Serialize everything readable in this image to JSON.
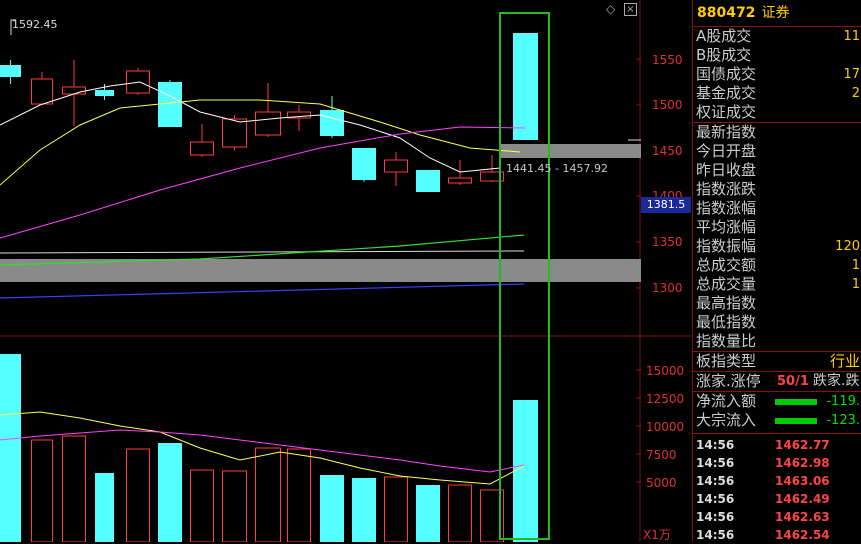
{
  "stock": {
    "code": "880472",
    "name": "证券"
  },
  "chart": {
    "top_label": "1592.45",
    "range_label": "1441.45 - 1457.92",
    "price_marker": "1381.5",
    "unit_label": "X1万",
    "price_ticks": [
      "1550",
      "1500",
      "1450",
      "1400",
      "1350",
      "1300"
    ],
    "vol_ticks": [
      "15000",
      "12500",
      "10000",
      "7500",
      "5000"
    ],
    "colors": {
      "up": "#ff3b3b",
      "down": "#55ffff",
      "ma5": "#ffffff",
      "ma10": "#ffff55",
      "ma20": "#ff44ff",
      "ma60": "#33dd33",
      "ma120": "#dddddd",
      "ma250": "#3344ff",
      "highlight": "#22bb22"
    }
  },
  "panel": {
    "rows": [
      {
        "label": "A股成交",
        "value": "11"
      },
      {
        "label": "B股成交",
        "value": ""
      },
      {
        "label": "国债成交",
        "value": "17"
      },
      {
        "label": "基金成交",
        "value": "2"
      },
      {
        "label": "权证成交",
        "value": ""
      }
    ],
    "rows2": [
      {
        "label": "最新指数",
        "value": ""
      },
      {
        "label": "今日开盘",
        "value": ""
      },
      {
        "label": "昨日收盘",
        "value": ""
      },
      {
        "label": "指数涨跌",
        "value": ""
      },
      {
        "label": "指数涨幅",
        "value": ""
      },
      {
        "label": "平均涨幅",
        "value": ""
      },
      {
        "label": "指数振幅",
        "value": "120"
      },
      {
        "label": "总成交额",
        "value": "1"
      },
      {
        "label": "总成交量",
        "value": "1"
      },
      {
        "label": "最高指数",
        "value": ""
      },
      {
        "label": "最低指数",
        "value": ""
      },
      {
        "label": "指数量比",
        "value": ""
      }
    ],
    "type_label": "板指类型",
    "type_value": "行业",
    "limit_label": "涨家.涨停",
    "limit_value": "50/1",
    "limit_extra": "跌家.跌",
    "flows": [
      {
        "label": "净流入额",
        "value": "-119."
      },
      {
        "label": "大宗流入",
        "value": "-123."
      }
    ],
    "ticks": [
      {
        "time": "14:56",
        "price": "1462.77"
      },
      {
        "time": "14:56",
        "price": "1462.98"
      },
      {
        "time": "14:56",
        "price": "1463.06"
      },
      {
        "time": "14:56",
        "price": "1462.49"
      },
      {
        "time": "14:56",
        "price": "1462.63"
      },
      {
        "time": "14:56",
        "price": "1462.54"
      }
    ]
  }
}
